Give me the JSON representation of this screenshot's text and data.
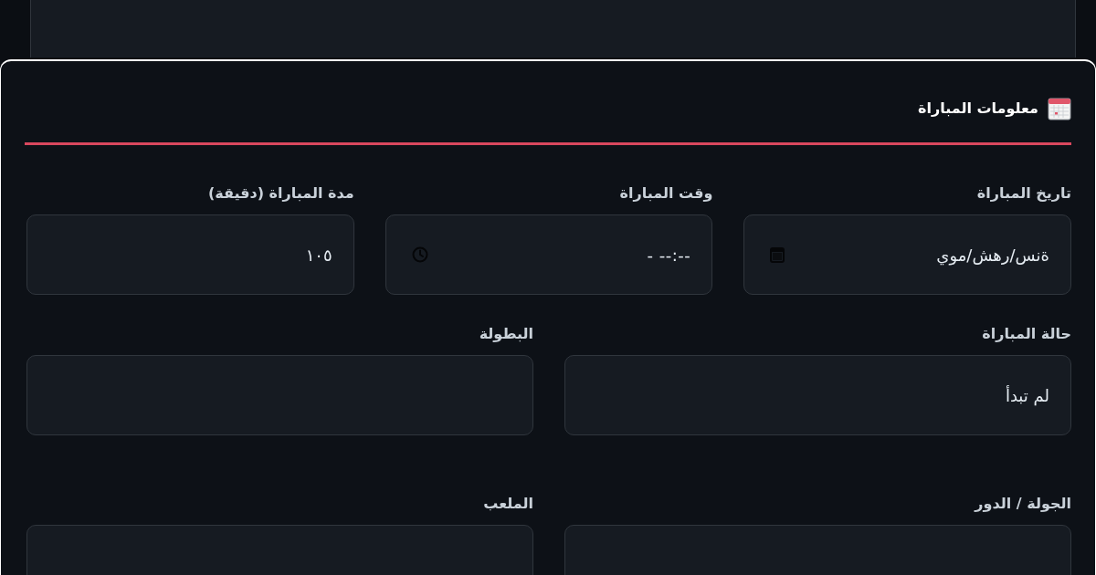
{
  "dialog": {
    "title": "معلومات المباراة",
    "rows": [
      {
        "fields": [
          {
            "label": "تاريخ المباراة",
            "kind": "date",
            "value": "ةنس/رهش/موي"
          },
          {
            "label": "وقت المباراة",
            "kind": "time",
            "value": "--:-- -"
          },
          {
            "label": "مدة المباراة (دقيقة)",
            "kind": "number",
            "value": "١٠٥"
          }
        ]
      },
      {
        "fields": [
          {
            "label": "حالة المباراة",
            "kind": "text",
            "value": "لم تبدأ"
          },
          {
            "label": "البطولة",
            "kind": "text"
          }
        ]
      },
      {
        "fields": [
          {
            "label": "الجولة / الدور",
            "kind": "text"
          },
          {
            "label": "الملعب",
            "kind": "text"
          }
        ]
      }
    ]
  }
}
